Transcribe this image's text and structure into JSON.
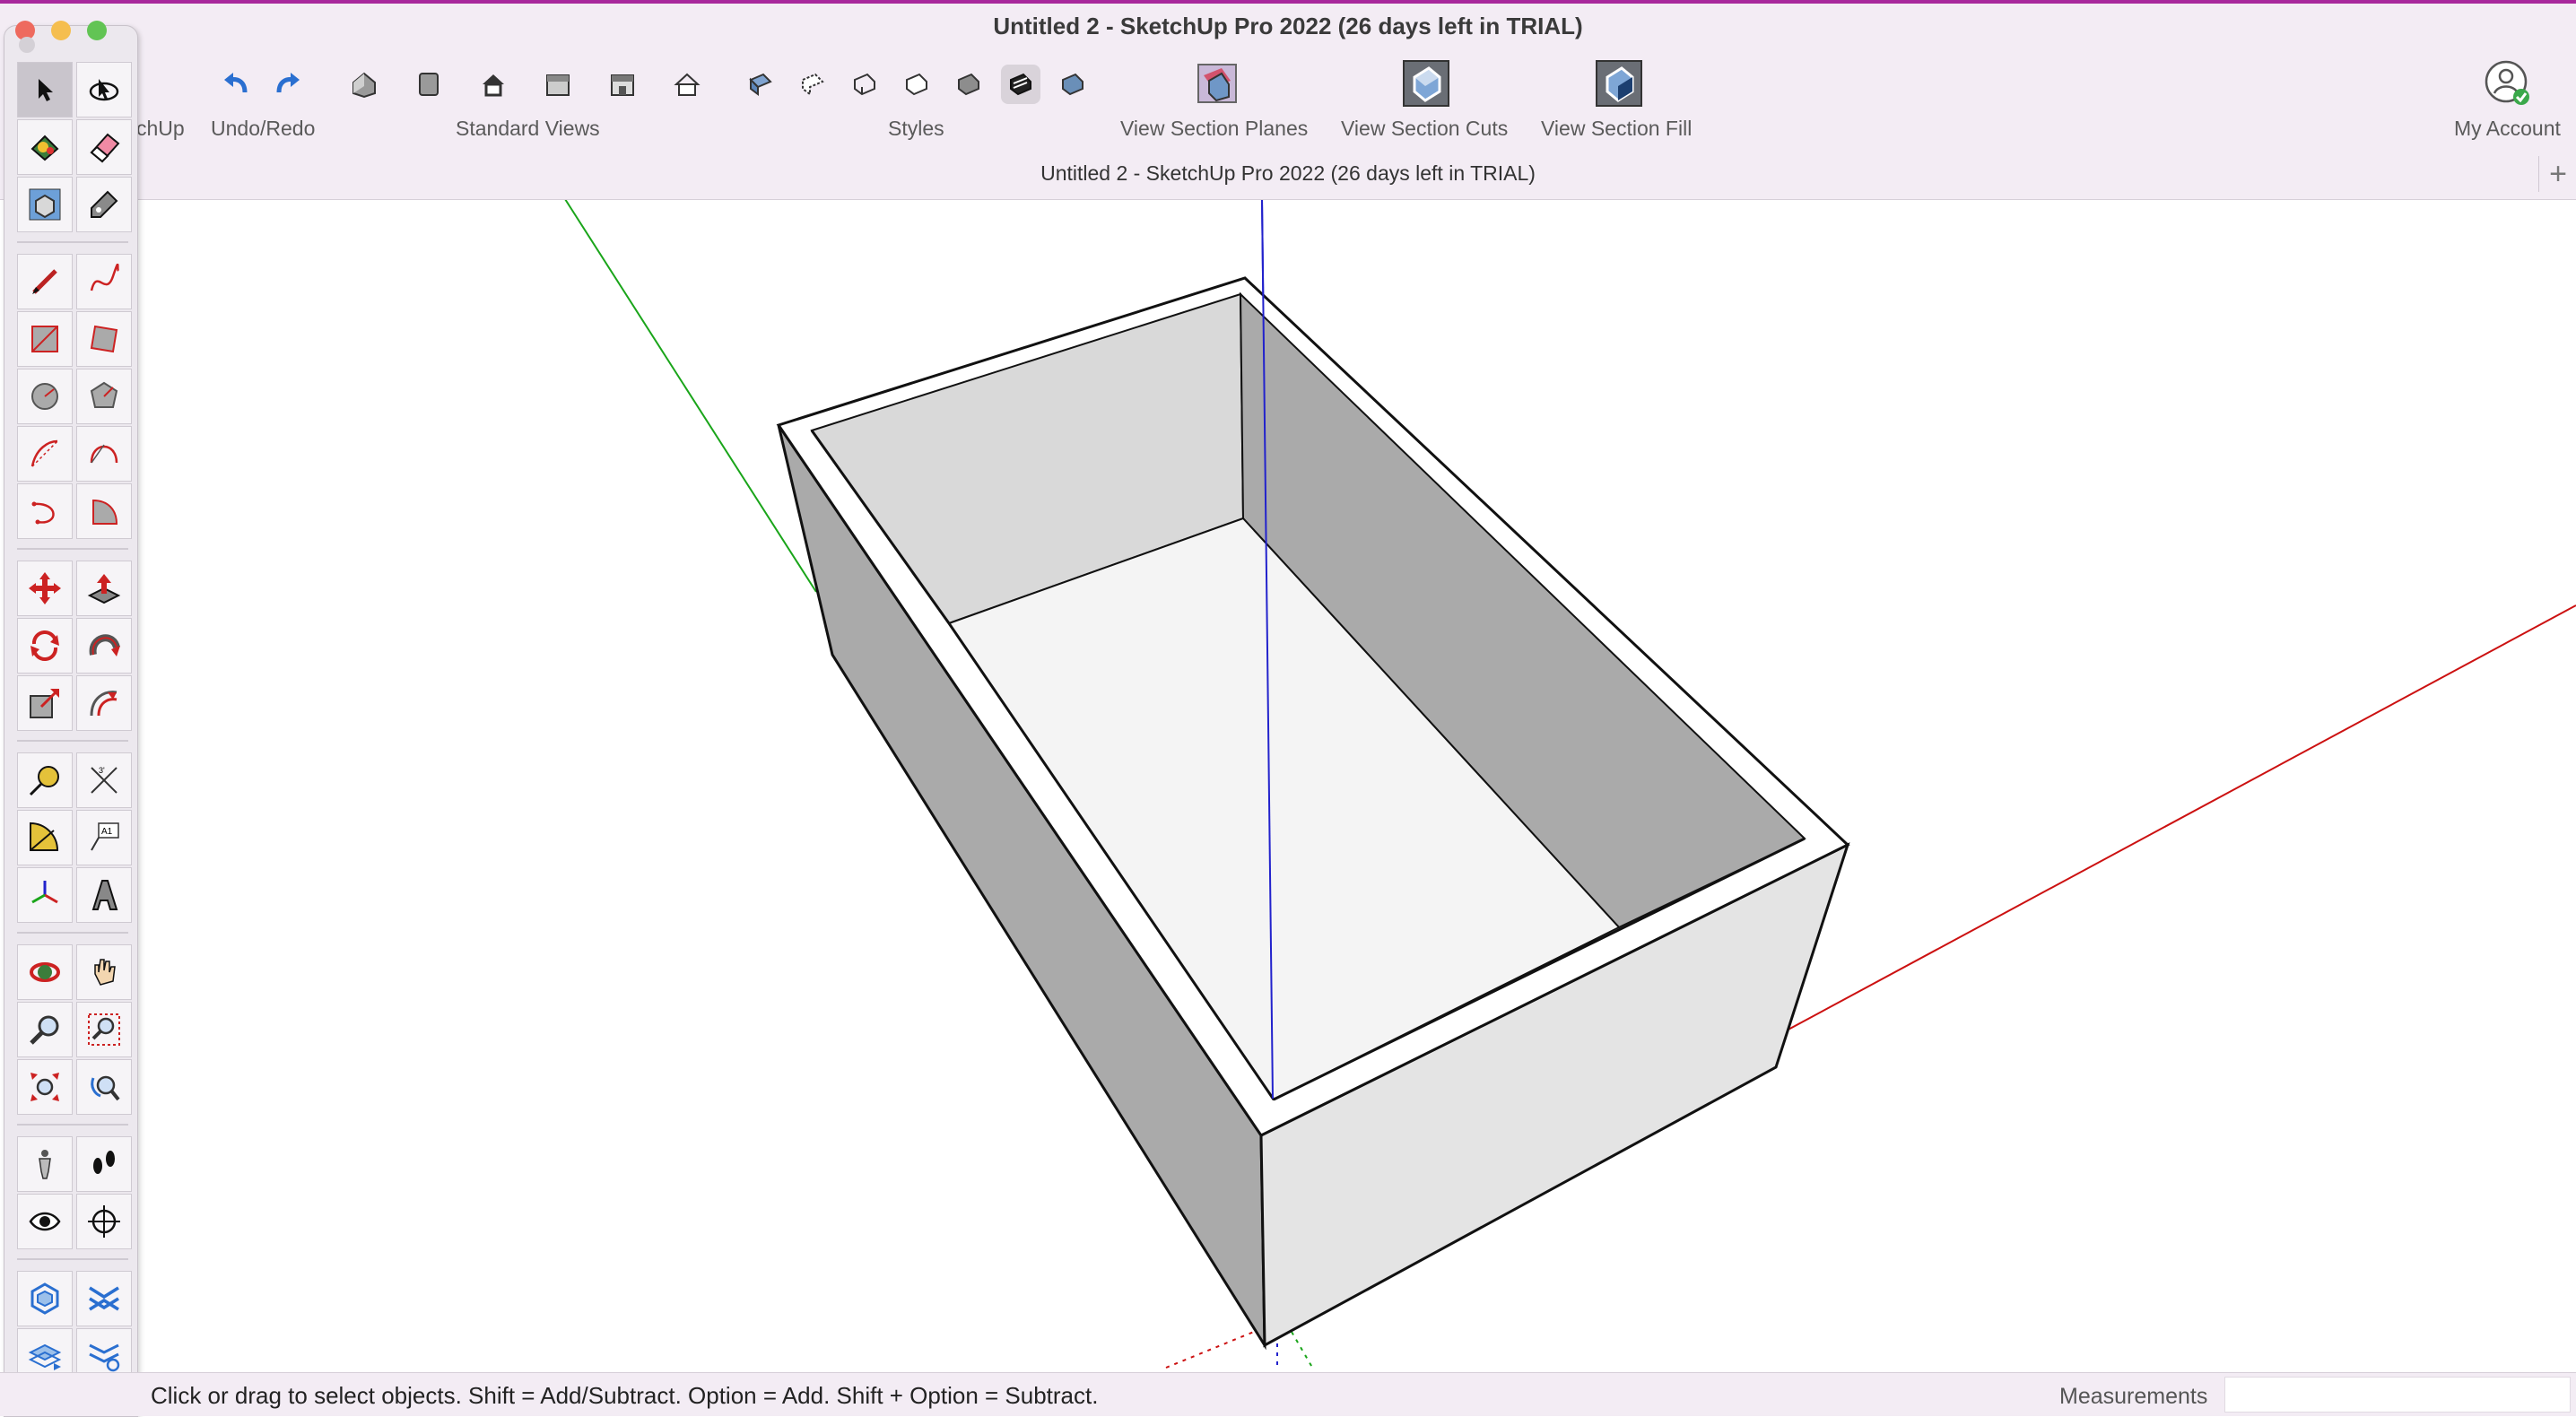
{
  "window": {
    "title": "Untitled 2 - SketchUp Pro 2022 (26 days left in TRIAL)",
    "document_title": "Untitled 2 - SketchUp Pro 2022 (26 days left in TRIAL)",
    "add_tab_symbol": "+"
  },
  "toolbar": {
    "getting_started_label": "chUp",
    "undo_redo_label": "Undo/Redo",
    "standard_views_label": "Standard Views",
    "styles_label": "Styles",
    "section_planes_label": "View Section Planes",
    "section_cuts_label": "View Section Cuts",
    "section_fill_label": "View Section Fill",
    "account_label": "My Account",
    "icons": [
      "undo-icon",
      "redo-icon",
      "iso-view-icon",
      "top-view-icon",
      "front-view-icon",
      "right-view-icon",
      "back-view-icon",
      "left-view-icon",
      "xray-icon",
      "back-edges-icon",
      "wireframe-icon",
      "hidden-line-icon",
      "shaded-icon",
      "shaded-textures-icon",
      "monochrome-icon",
      "section-planes-icon",
      "section-cuts-icon",
      "section-fill-icon",
      "account-icon"
    ],
    "active_style": "shaded-textures"
  },
  "palette": {
    "tools": [
      "select",
      "orbit",
      "paint-bucket",
      "eraser",
      "make-component",
      "tag",
      "line",
      "freehand",
      "rectangle",
      "rotated-rectangle",
      "circle",
      "polygon",
      "arc",
      "2-point-arc",
      "3-point-arc",
      "pie",
      "move",
      "push-pull",
      "rotate",
      "follow-me",
      "scale",
      "offset",
      "tape-measure",
      "dimension",
      "protractor",
      "text",
      "axes",
      "3d-text",
      "orbit-view",
      "pan",
      "zoom",
      "zoom-window",
      "zoom-extents",
      "previous-view",
      "position-camera",
      "walk",
      "look-around",
      "section-plane",
      "solid-tools",
      "outer-shell",
      "sandbox-from-contours",
      "sandbox-settings"
    ],
    "selected_tool": "select"
  },
  "status": {
    "message": "Click or drag to select objects. Shift = Add/Subtract. Option = Add. Shift + Option = Subtract.",
    "measurements_label": "Measurements",
    "measurements_value": ""
  },
  "colors": {
    "axis_green": "#1aa51a",
    "axis_blue": "#2222cc",
    "axis_red": "#cc1111",
    "face_light": "#e4e4e4",
    "face_dark": "#aaaaaa",
    "face_floor": "#f4f4f4",
    "face_inner_back": "#d9d9d9",
    "toolbar_bg": "#f3ecf4",
    "accent_top": "#a8289c"
  }
}
